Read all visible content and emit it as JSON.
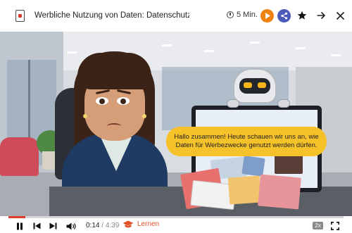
{
  "header": {
    "title": "Werbliche Nutzung von Daten: Datenschutzrecht i",
    "duration": "5 Min."
  },
  "video": {
    "speech_bubble": "Hallo zusammen! Heute schauen wir uns an, wie Daten für Werbezwecke genutzt werden dürfen."
  },
  "controls": {
    "current_time": "0:14",
    "separator": "/",
    "total_time": "4:39",
    "progress_fraction": 0.05,
    "learn_label": "Lernen",
    "speed_label": "2x"
  },
  "colors": {
    "accent_orange": "#f0820f",
    "share_blue": "#4a5bb8",
    "progress_red": "#e03c2e",
    "bubble_yellow": "#f6c22a"
  },
  "icons": [
    "document-icon",
    "clock-icon",
    "play-circle-icon",
    "share-icon",
    "star-icon",
    "arrow-right-icon",
    "close-icon",
    "pause-icon",
    "skip-back-icon",
    "skip-forward-icon",
    "volume-icon",
    "graduation-cap-icon",
    "fullscreen-icon"
  ]
}
